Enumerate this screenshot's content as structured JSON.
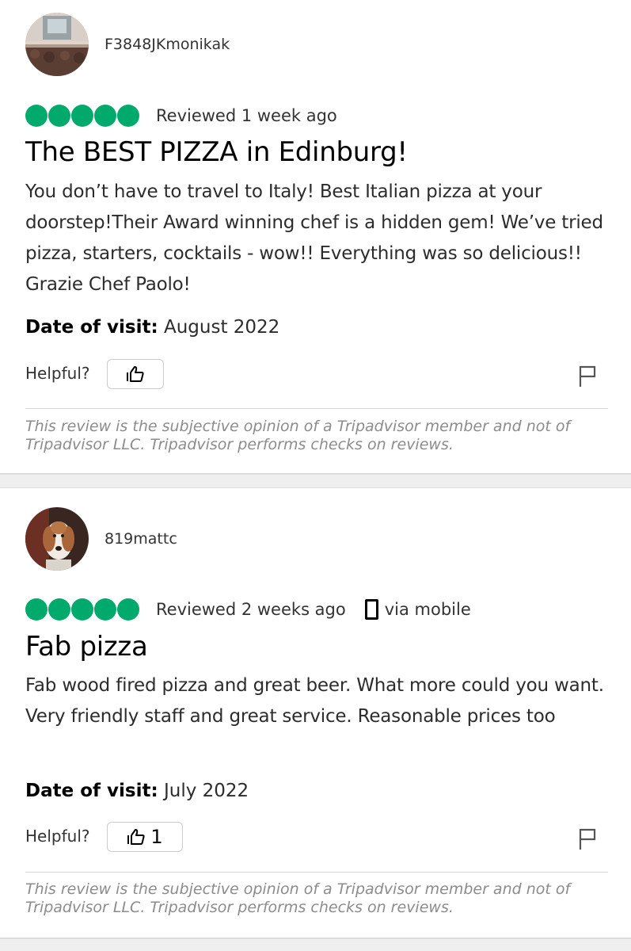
{
  "colors": {
    "rating_bubble": "#00aa6c",
    "separator": "#efefef"
  },
  "reviews": [
    {
      "username": "F3848JKmonikak",
      "avatar_icon": "concert-crowd-avatar",
      "rating": 5,
      "reviewed": "Reviewed 1 week ago",
      "title": "The BEST PIZZA in Edinburg!",
      "text": "You don’t have to travel to Italy! Best Italian pizza at your doorstep!Their Award winning chef is a hidden gem! We’ve tried pizza, starters, cocktails - wow!! Everything was so delicious!! Grazie Chef Paolo!",
      "visit_label": "Date of visit:",
      "visit_date": "August 2022",
      "helpful_label": "Helpful?",
      "disclaimer": "This review is the subjective opinion of a Tripadvisor member and not of Tripadvisor LLC. Tripadvisor performs checks on reviews."
    },
    {
      "username": "819mattc",
      "avatar_icon": "dog-avatar",
      "rating": 5,
      "reviewed": "Reviewed 2 weeks ago",
      "via_mobile": "via mobile",
      "title": "Fab pizza",
      "text": "Fab wood fired pizza and great beer. What more could you want. Very friendly staff and great service. Reasonable prices too",
      "visit_label": "Date of visit:",
      "visit_date": "July 2022",
      "helpful_label": "Helpful?",
      "helpful_count": "1",
      "disclaimer": "This review is the subjective opinion of a Tripadvisor member and not of Tripadvisor LLC. Tripadvisor performs checks on reviews."
    }
  ]
}
